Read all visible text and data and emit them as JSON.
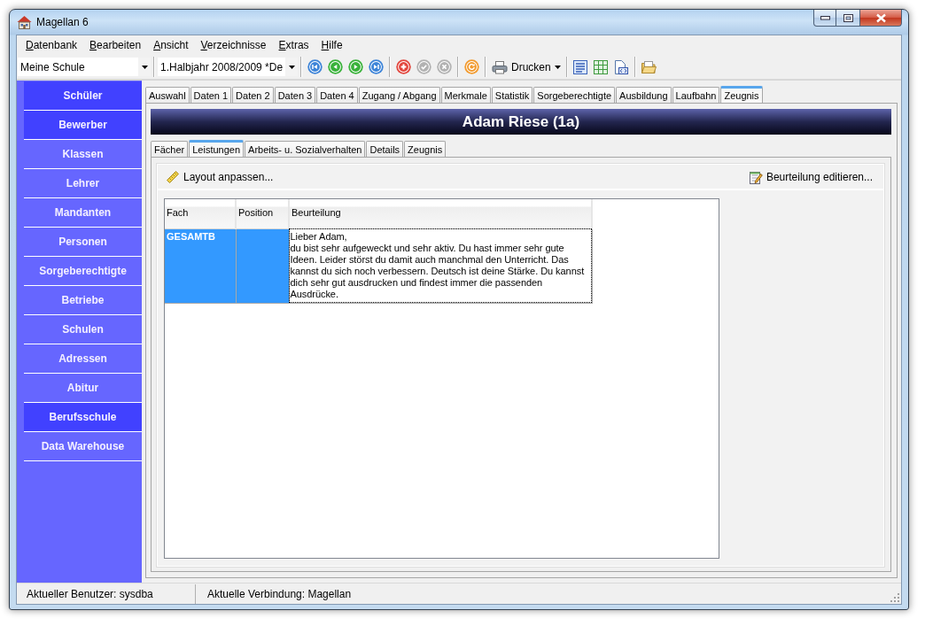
{
  "window": {
    "title": "Magellan 6"
  },
  "menu": [
    "Datenbank",
    "Bearbeiten",
    "Ansicht",
    "Verzeichnisse",
    "Extras",
    "Hilfe"
  ],
  "toolbar": {
    "school": {
      "value": "Meine Schule"
    },
    "period": {
      "value": "1.Halbjahr 2008/2009 *De"
    },
    "groups": [
      [
        {
          "kind": "first",
          "disabled": false
        },
        {
          "kind": "previous",
          "disabled": false
        },
        {
          "kind": "next",
          "disabled": false
        },
        {
          "kind": "last",
          "disabled": false
        }
      ],
      [
        {
          "kind": "add",
          "disabled": false
        },
        {
          "kind": "confirm",
          "disabled": true
        },
        {
          "kind": "cancel",
          "disabled": true
        }
      ],
      [
        {
          "kind": "refresh",
          "disabled": false
        }
      ],
      [
        {
          "kind": "print",
          "label": "Drucken",
          "disabled": false
        }
      ],
      [
        {
          "kind": "document",
          "disabled": false
        },
        {
          "kind": "spreadsheet",
          "disabled": false
        },
        {
          "kind": "webpage",
          "disabled": false
        }
      ],
      [
        {
          "kind": "folder",
          "disabled": false
        }
      ]
    ]
  },
  "sidebar": {
    "items": [
      {
        "label": "Schüler",
        "selected": true
      },
      {
        "label": "Bewerber",
        "selected": true
      },
      {
        "label": "Klassen",
        "selected": false
      },
      {
        "label": "Lehrer",
        "selected": false
      },
      {
        "label": "Mandanten",
        "selected": false
      },
      {
        "label": "Personen",
        "selected": false
      },
      {
        "label": "Sorgeberechtigte",
        "selected": false
      },
      {
        "label": "Betriebe",
        "selected": false
      },
      {
        "label": "Schulen",
        "selected": false
      },
      {
        "label": "Adressen",
        "selected": false
      },
      {
        "label": "Abitur",
        "selected": false
      },
      {
        "label": "Berufsschule",
        "selected": true
      },
      {
        "label": "Data Warehouse",
        "selected": false
      }
    ]
  },
  "tabs": [
    {
      "label": "Auswahl",
      "selected": false
    },
    {
      "label": "Daten 1",
      "selected": false
    },
    {
      "label": "Daten 2",
      "selected": false
    },
    {
      "label": "Daten 3",
      "selected": false
    },
    {
      "label": "Daten 4",
      "selected": false
    },
    {
      "label": "Zugang / Abgang",
      "selected": false
    },
    {
      "label": "Merkmale",
      "selected": false
    },
    {
      "label": "Statistik",
      "selected": false
    },
    {
      "label": "Sorgeberechtigte",
      "selected": false
    },
    {
      "label": "Ausbildung",
      "selected": false
    },
    {
      "label": "Laufbahn",
      "selected": false
    },
    {
      "label": "Zeugnis",
      "selected": true
    }
  ],
  "header": {
    "title": "Adam Riese (1a)"
  },
  "subtabs": [
    {
      "label": "Fächer",
      "selected": false
    },
    {
      "label": "Leistungen",
      "selected": true
    },
    {
      "label": "Arbeits- u. Sozialverhalten",
      "selected": false
    },
    {
      "label": "Details",
      "selected": false
    },
    {
      "label": "Zeugnis",
      "selected": false
    }
  ],
  "panel_toolbar": {
    "actions": [
      {
        "kind": "layout",
        "label": "Layout anpassen..."
      },
      {
        "kind": "edit",
        "label": "Beurteilung editieren..."
      }
    ]
  },
  "grid": {
    "columns": [
      "Fach",
      "Position",
      "Beurteilung"
    ],
    "rows": [
      {
        "selected": true,
        "subject": "GESAMTB",
        "assessment": "Lieber Adam,\ndu bist sehr aufgeweckt und sehr aktiv. Du hast immer sehr gute Ideen. Leider störst du damit auch manchmal den Unterricht. Das kannst du sich noch verbessern. Deutsch ist deine Stärke. Du kannst dich sehr gut ausdrucken und findest immer die passenden Ausdrücke."
      }
    ]
  },
  "status_bar": [
    "Aktueller Benutzer: sysdba",
    "Aktuelle Verbindung: Magellan"
  ]
}
